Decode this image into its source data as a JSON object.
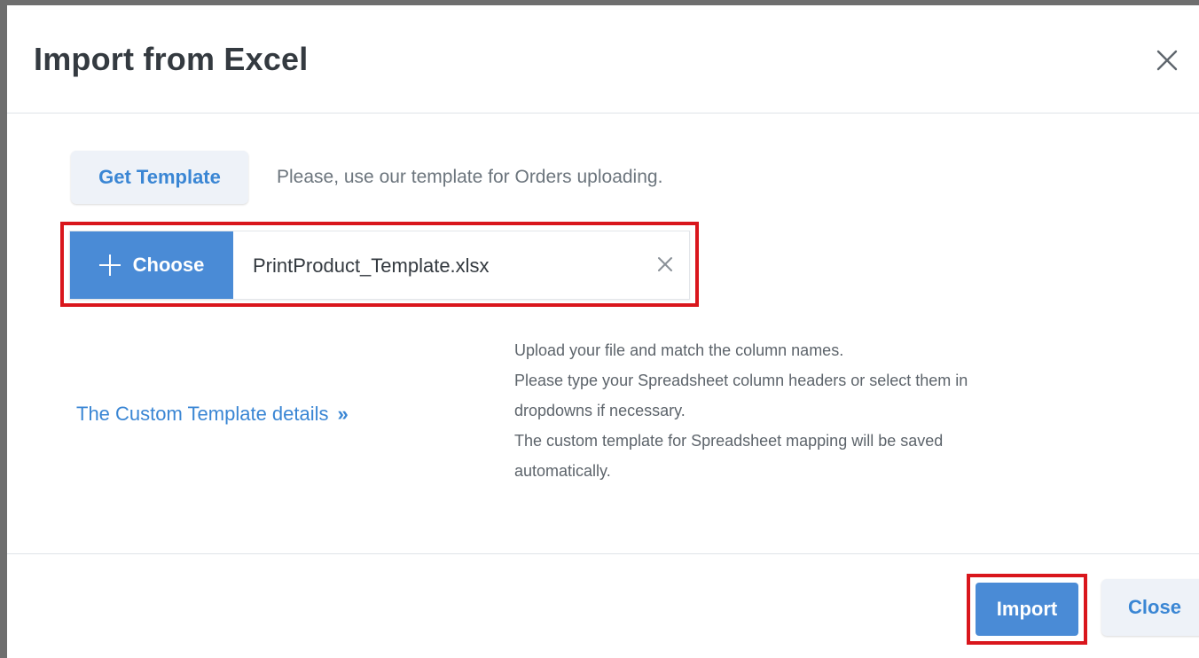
{
  "dialog": {
    "title": "Import from Excel"
  },
  "template": {
    "button_label": "Get Template",
    "hint": "Please, use our template for Orders uploading."
  },
  "upload": {
    "choose_label": "Choose",
    "file_name": "PrintProduct_Template.xlsx"
  },
  "custom_template": {
    "link_label": "The Custom Template details",
    "link_chevron": "»",
    "info_lines": [
      "Upload your file and match the column names.",
      "Please type your Spreadsheet column headers or select them in",
      "dropdowns if necessary.",
      "The custom template for Spreadsheet mapping will be saved",
      "automatically."
    ]
  },
  "footer": {
    "import_label": "Import",
    "close_label": "Close"
  },
  "colors": {
    "accent": "#4a8bd6",
    "link": "#3a86d4",
    "highlight": "#d9161c",
    "secondary_button_bg": "#eef2f8"
  },
  "icons": {
    "close": "close-icon",
    "plus": "plus-icon",
    "clear": "clear-file-icon"
  }
}
